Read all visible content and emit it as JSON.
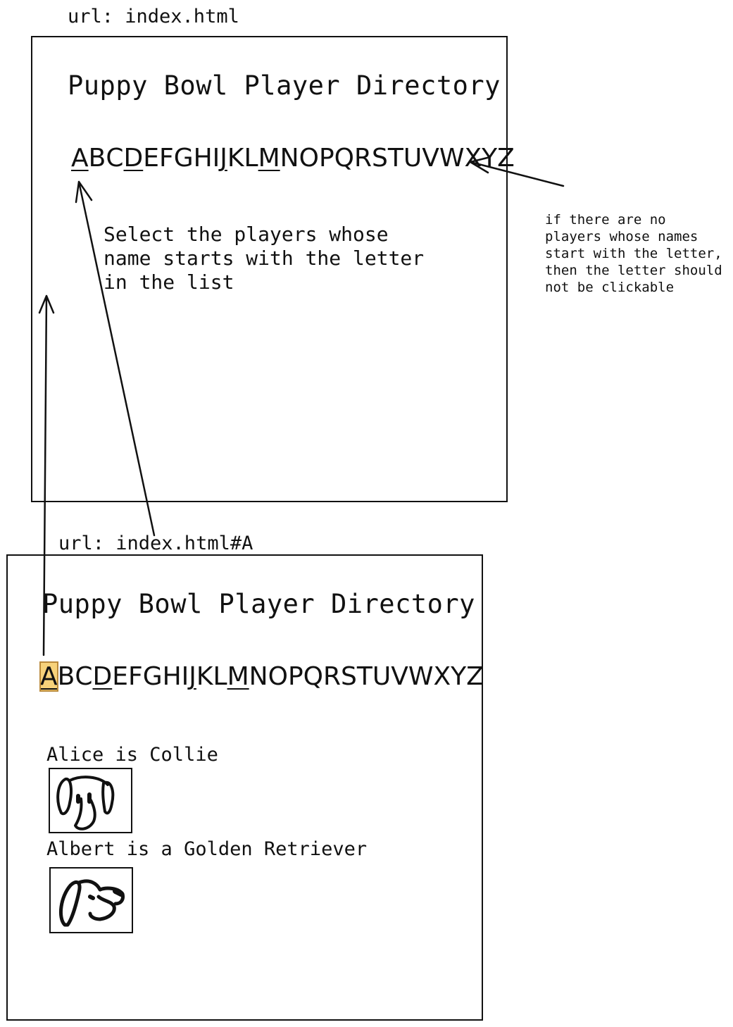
{
  "screen1": {
    "url": "url: index.html",
    "title": "Puppy Bowl Player Directory",
    "letters": [
      {
        "letter": "A",
        "clickable": true
      },
      {
        "letter": "B",
        "clickable": false
      },
      {
        "letter": "C",
        "clickable": false
      },
      {
        "letter": "D",
        "clickable": true
      },
      {
        "letter": "E",
        "clickable": false
      },
      {
        "letter": "F",
        "clickable": false
      },
      {
        "letter": "G",
        "clickable": false
      },
      {
        "letter": "H",
        "clickable": false
      },
      {
        "letter": "I",
        "clickable": false
      },
      {
        "letter": "J",
        "clickable": true
      },
      {
        "letter": "K",
        "clickable": false
      },
      {
        "letter": "L",
        "clickable": false
      },
      {
        "letter": "M",
        "clickable": true
      },
      {
        "letter": "N",
        "clickable": false
      },
      {
        "letter": "O",
        "clickable": false
      },
      {
        "letter": "P",
        "clickable": false
      },
      {
        "letter": "Q",
        "clickable": false
      },
      {
        "letter": "R",
        "clickable": false
      },
      {
        "letter": "S",
        "clickable": false
      },
      {
        "letter": "T",
        "clickable": false
      },
      {
        "letter": "U",
        "clickable": false
      },
      {
        "letter": "V",
        "clickable": false
      },
      {
        "letter": "W",
        "clickable": false
      },
      {
        "letter": "X",
        "clickable": false
      },
      {
        "letter": "Y",
        "clickable": false
      },
      {
        "letter": "Z",
        "clickable": false
      }
    ],
    "hint_lines": [
      "Select the players whose",
      "name starts with the letter",
      "in the list"
    ]
  },
  "side_note_lines": [
    "if there are no",
    "players whose names",
    "start with the letter,",
    "then the letter should",
    "not be clickable"
  ],
  "screen2": {
    "url": "url: index.html#A",
    "title": "Puppy Bowl Player Directory",
    "selected_letter": "A",
    "players": [
      {
        "caption": "Alice is Collie",
        "image_icon": "dog-collie-icon"
      },
      {
        "caption": "Albert is a Golden Retriever",
        "image_icon": "dog-golden-retriever-icon"
      }
    ]
  }
}
